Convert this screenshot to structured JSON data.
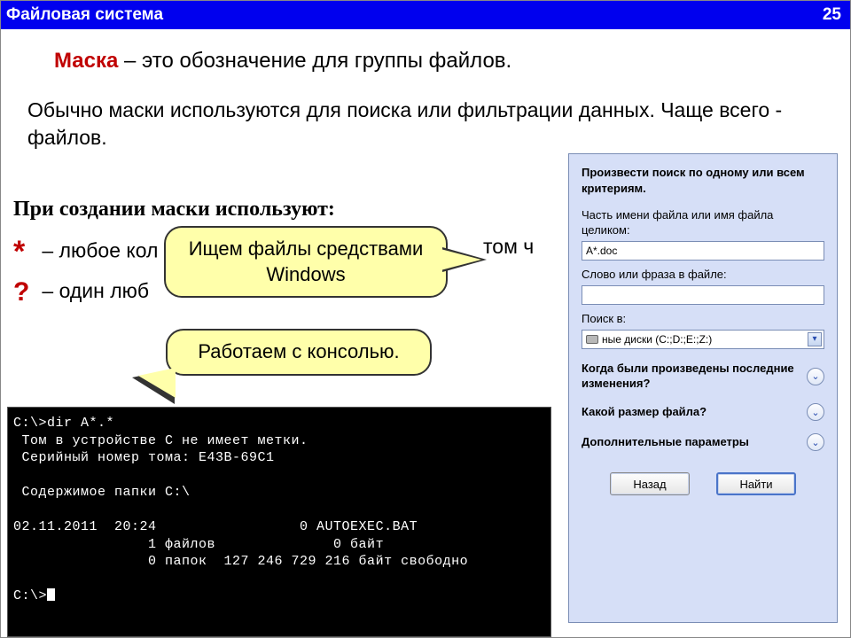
{
  "titlebar": {
    "title": "Файловая система",
    "page": "25"
  },
  "heading": {
    "mask": "Маска",
    "rest": " – это обозначение для группы файлов."
  },
  "para1": "Обычно маски используются для поиска или фильтрации данных. Чаще всего - файлов.",
  "subhead": "При создании маски используют:",
  "star": {
    "sym": "*",
    "lead": " – любое кол",
    "tail": "том ч"
  },
  "qmark": {
    "sym": "?",
    "lead": " – один люб"
  },
  "callout1": "Ищем файлы средствами Windows",
  "callout2": "Работаем с консолью.",
  "console_lines": [
    "C:\\>dir A*.*",
    " Том в устройстве C не имеет метки.",
    " Серийный номер тома: E43B-69C1",
    "",
    " Содержимое папки C:\\",
    "",
    "02.11.2011  20:24                 0 AUTOEXEC.BAT",
    "                1 файлов              0 байт",
    "                0 папок  127 246 729 216 байт свободно",
    "",
    "C:\\>"
  ],
  "search": {
    "intro": "Произвести поиск по одному или всем критериям.",
    "name_label": "Часть имени файла или имя файла целиком:",
    "name_value": "A*.doc",
    "phrase_label": "Слово или фраза в файле:",
    "phrase_value": "",
    "where_label": "Поиск в:",
    "where_value": "ные диски (C:;D:;E:;Z:)",
    "q_changes": "Когда были произведены последние изменения?",
    "q_size": "Какой размер файла?",
    "q_more": "Дополнительные параметры",
    "btn_back": "Назад",
    "btn_find": "Найти"
  }
}
